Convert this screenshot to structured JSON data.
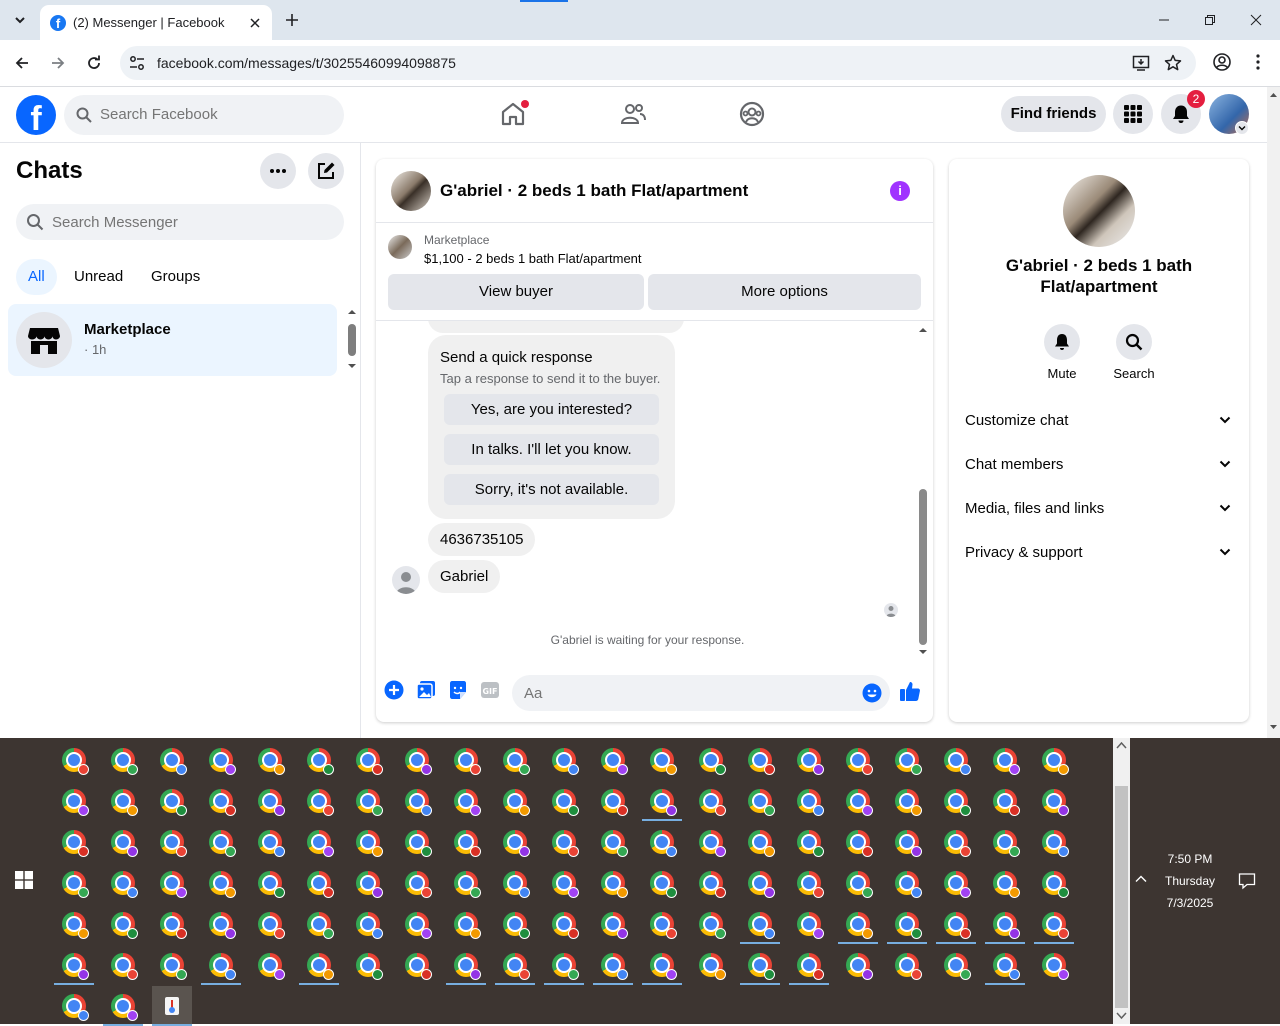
{
  "browser": {
    "tab_title": "(2) Messenger | Facebook",
    "favicon_letter": "f",
    "url": "facebook.com/messages/t/30255460994098875"
  },
  "fb_header": {
    "logo_letter": "f",
    "search_placeholder": "Search Facebook",
    "find_friends_label": "Find friends",
    "notification_count": "2"
  },
  "left_panel": {
    "title": "Chats",
    "search_placeholder": "Search Messenger",
    "filters": [
      "All",
      "Unread",
      "Groups"
    ],
    "chats": [
      {
        "name": "Marketplace",
        "time": "· 1h"
      }
    ]
  },
  "conversation": {
    "title": "G'abriel · 2 beds 1 bath Flat/apartment",
    "info_glyph": "i",
    "marketplace_label": "Marketplace",
    "listing": "$1,100 - 2 beds 1 bath Flat/apartment",
    "view_buyer_label": "View buyer",
    "more_options_label": "More options",
    "quick_response": {
      "title": "Send a quick response",
      "subtitle": "Tap a response to send it to the buyer.",
      "options": [
        "Yes, are you interested?",
        "In talks. I'll let you know.",
        "Sorry, it's not available."
      ]
    },
    "messages": [
      "4636735105",
      "Gabriel"
    ],
    "waiting_text": "G'abriel is waiting for your response.",
    "composer_placeholder": "Aa"
  },
  "right_panel": {
    "title": "G'abriel · 2 beds 1 bath Flat/apartment",
    "actions": [
      {
        "label": "Mute",
        "icon": "bell-icon"
      },
      {
        "label": "Search",
        "icon": "search-icon"
      }
    ],
    "sections": [
      "Customize chat",
      "Chat members",
      "Media, files and links",
      "Privacy & support"
    ]
  },
  "taskbar": {
    "time": "7:50 PM",
    "day": "Thursday",
    "date": "7/3/2025"
  },
  "colors": {
    "fb_blue": "#0866ff",
    "messenger_purple": "#a033ff",
    "badge_red": "#e41e3f",
    "taskbar_bg": "#3d3531"
  }
}
